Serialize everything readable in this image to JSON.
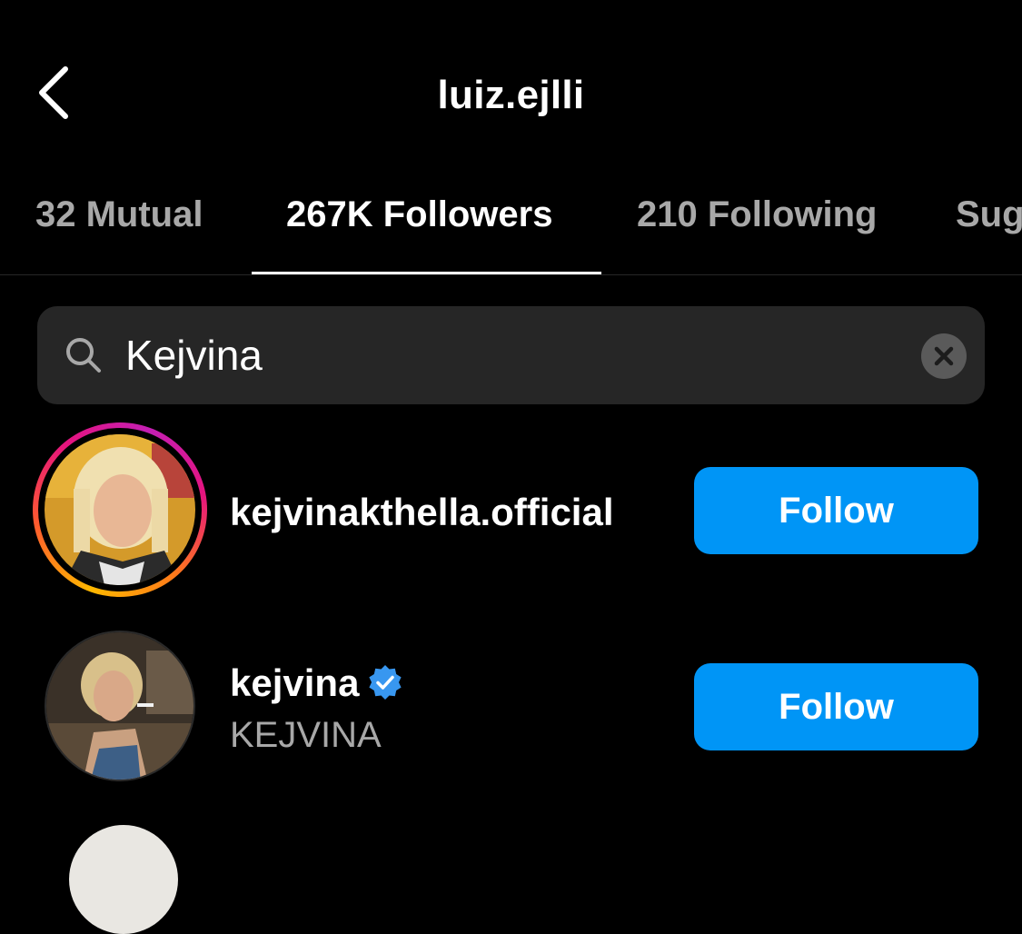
{
  "header": {
    "title": "luiz.ejlli",
    "back_icon": "chevron-left-icon"
  },
  "tabs": [
    {
      "label": "32 Mutual",
      "active": false
    },
    {
      "label": "267K Followers",
      "active": true
    },
    {
      "label": "210 Following",
      "active": false
    },
    {
      "label": "Sug",
      "active": false
    }
  ],
  "search": {
    "icon": "search-icon",
    "value": "Kejvina",
    "clear_icon": "close-icon"
  },
  "results": [
    {
      "username": "kejvinakthella.official",
      "full_name": "",
      "verified": false,
      "has_story": true,
      "button_label": "Follow"
    },
    {
      "username": "kejvina",
      "full_name": "KEJVINA",
      "verified": true,
      "has_story": false,
      "button_label": "Follow"
    }
  ],
  "colors": {
    "background": "#000000",
    "follow_button": "#0095f6",
    "secondary_text": "#a8a8a8",
    "search_bg": "#262626",
    "verified_badge": "#3897f0"
  }
}
